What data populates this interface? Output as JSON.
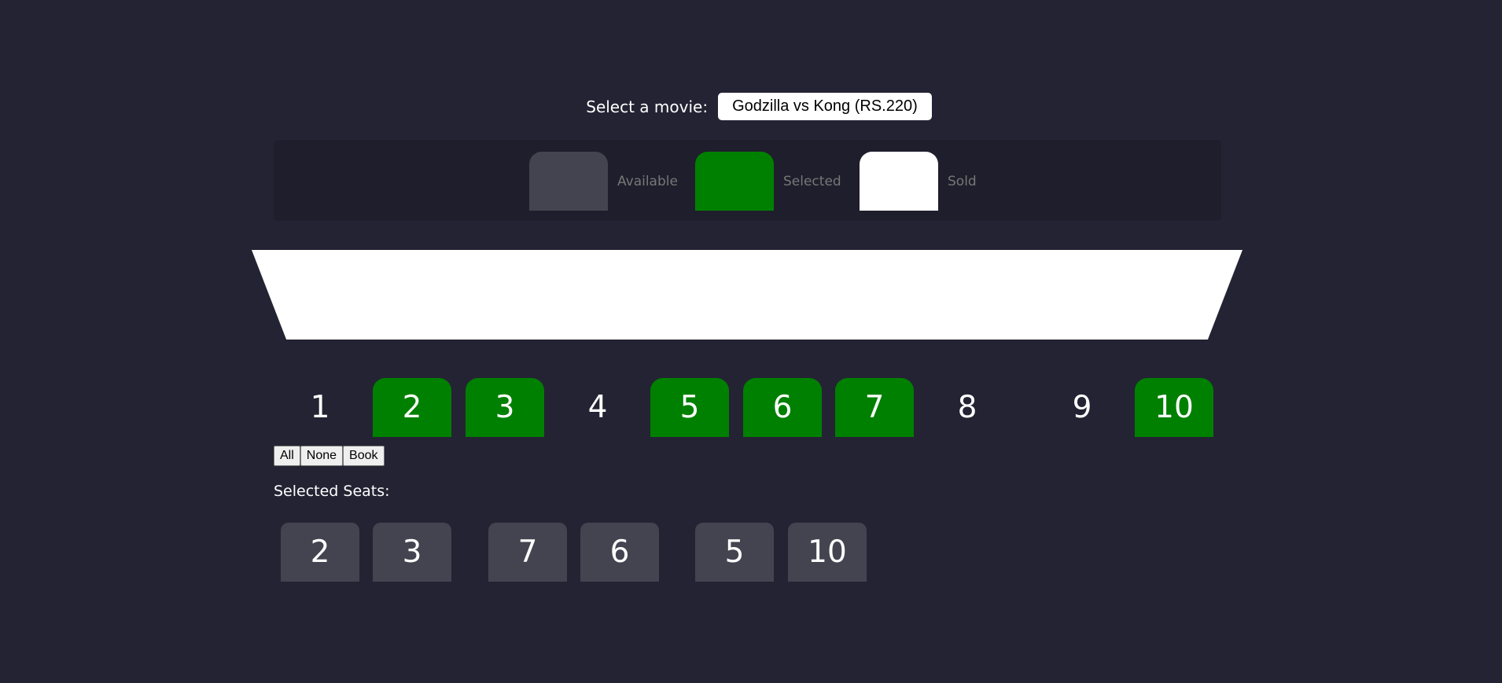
{
  "movie": {
    "label": "Select a movie:",
    "selected": "Godzilla vs Kong (RS.220)"
  },
  "legend": [
    {
      "label": "Available",
      "color": "#444451"
    },
    {
      "label": "Selected",
      "color": "#008000"
    },
    {
      "label": "Sold",
      "color": "#ffffff"
    }
  ],
  "seats": [
    {
      "number": "1",
      "state": "available"
    },
    {
      "number": "2",
      "state": "selected"
    },
    {
      "number": "3",
      "state": "selected"
    },
    {
      "number": "4",
      "state": "available"
    },
    {
      "number": "5",
      "state": "selected"
    },
    {
      "number": "6",
      "state": "selected"
    },
    {
      "number": "7",
      "state": "selected"
    },
    {
      "number": "8",
      "state": "available"
    },
    {
      "number": "9",
      "state": "available"
    },
    {
      "number": "10",
      "state": "selected"
    }
  ],
  "buttons": {
    "all": "All",
    "none": "None",
    "book": "Book"
  },
  "selected_seats": {
    "label": "Selected Seats:",
    "items": [
      "2",
      "3",
      "7",
      "6",
      "5",
      "10"
    ]
  },
  "colors": {
    "background": "#242333",
    "selected": "#008000",
    "available": "#444451",
    "sold": "#ffffff"
  }
}
